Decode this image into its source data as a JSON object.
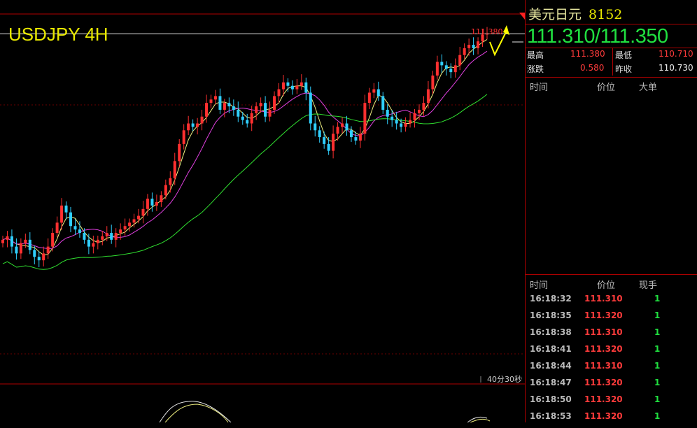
{
  "chart": {
    "symbol_label": "USDJPY 4H",
    "last_marker_label": "111.380",
    "timer_label": "40分30秒"
  },
  "quote": {
    "name": "美元日元",
    "code": "8152",
    "bid_ask": "111.310/111.350",
    "high_label": "最高",
    "high_value": "111.380",
    "low_label": "最低",
    "low_value": "110.710",
    "change_label": "涨跌",
    "change_value": "0.580",
    "prev_close_label": "昨收",
    "prev_close_value": "110.730",
    "col_time": "时间",
    "col_price": "价位",
    "col_big": "大单",
    "col_volume": "现手"
  },
  "trades": [
    {
      "time": "16:18:32",
      "price": "111.310",
      "volume": "1"
    },
    {
      "time": "16:18:35",
      "price": "111.320",
      "volume": "1"
    },
    {
      "time": "16:18:38",
      "price": "111.310",
      "volume": "1"
    },
    {
      "time": "16:18:41",
      "price": "111.320",
      "volume": "1"
    },
    {
      "time": "16:18:44",
      "price": "111.310",
      "volume": "1"
    },
    {
      "time": "16:18:47",
      "price": "111.320",
      "volume": "1"
    },
    {
      "time": "16:18:50",
      "price": "111.320",
      "volume": "1"
    },
    {
      "time": "16:18:53",
      "price": "111.320",
      "volume": "1"
    }
  ],
  "colors": {
    "up": "#ff3030",
    "down": "#30d0ff",
    "ma_fast": "#f0f080",
    "ma_mid": "#e040e0",
    "ma_slow": "#30e030",
    "arrow": "#ffff00"
  },
  "chart_data": {
    "type": "candlestick",
    "title": "USDJPY 4H",
    "ylim": [
      107.0,
      111.6
    ],
    "closes": [
      108.3,
      108.35,
      108.2,
      108.1,
      108.25,
      108.3,
      108.15,
      108.05,
      108.0,
      108.1,
      108.2,
      108.4,
      108.55,
      108.8,
      108.7,
      108.5,
      108.45,
      108.4,
      108.3,
      108.2,
      108.25,
      108.3,
      108.35,
      108.4,
      108.3,
      108.4,
      108.45,
      108.5,
      108.55,
      108.6,
      108.65,
      108.75,
      108.9,
      108.8,
      108.85,
      108.95,
      109.1,
      109.2,
      109.45,
      109.7,
      109.9,
      110.0,
      109.95,
      110.0,
      110.1,
      110.3,
      110.35,
      110.4,
      110.2,
      110.3,
      110.25,
      110.2,
      110.1,
      110.05,
      110.0,
      110.15,
      110.25,
      110.3,
      110.1,
      110.2,
      110.4,
      110.5,
      110.6,
      110.55,
      110.5,
      110.55,
      110.6,
      110.45,
      110.0,
      109.9,
      109.8,
      109.7,
      109.6,
      109.85,
      109.95,
      110.0,
      109.9,
      109.8,
      109.75,
      109.85,
      110.3,
      110.45,
      110.5,
      110.4,
      110.2,
      110.1,
      110.05,
      110.0,
      109.95,
      110.0,
      110.05,
      110.15,
      110.2,
      110.3,
      110.5,
      110.7,
      110.9,
      110.85,
      110.8,
      110.75,
      110.85,
      111.0,
      111.1,
      111.15,
      111.1,
      111.2,
      111.3,
      111.31
    ]
  }
}
